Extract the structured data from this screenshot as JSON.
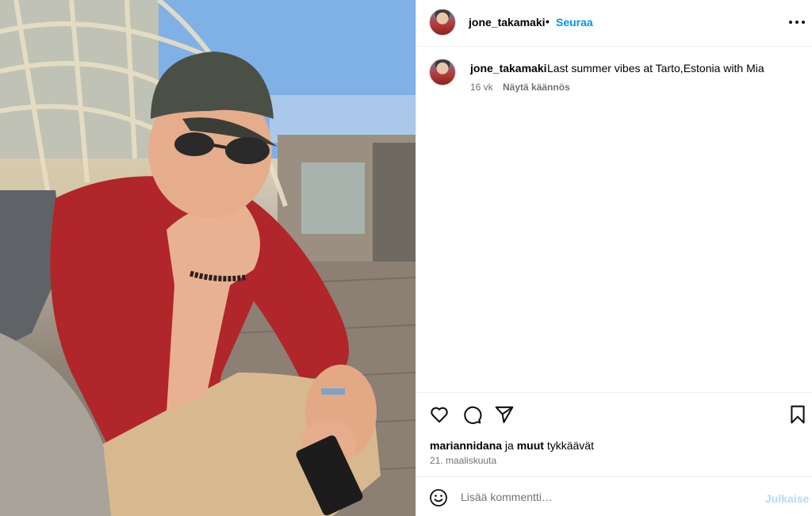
{
  "post": {
    "username": "jone_takamaki",
    "separator": "•",
    "follow_label": "Seuraa",
    "caption_text": "Last summer vibes at Tarto,Estonia with Mia",
    "caption_age": "16 vk",
    "translate_label": "Näytä käännös"
  },
  "engagement": {
    "liked_by_user": "mariannidana",
    "liked_by_mid": " ja ",
    "liked_by_others": "muut",
    "liked_by_suffix": " tykkäävät",
    "date": "21. maaliskuuta"
  },
  "comment": {
    "placeholder": "Lisää kommentti…",
    "post_label": "Julkaise"
  },
  "icons": {
    "more": "more-options-icon",
    "like": "heart-icon",
    "comment": "comment-icon",
    "share": "paper-plane-icon",
    "save": "bookmark-icon",
    "emoji": "emoji-icon"
  },
  "colors": {
    "accent": "#0095f6",
    "muted_text": "#737373",
    "disabled_post": "#b3dbff"
  }
}
